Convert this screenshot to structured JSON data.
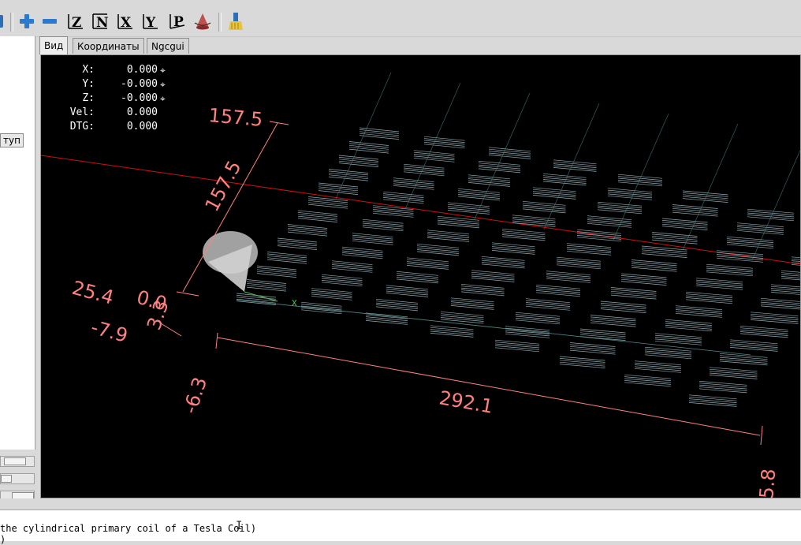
{
  "toolbar": {
    "buttons": [
      {
        "name": "zoom-in",
        "icon": "plus-icon"
      },
      {
        "name": "zoom-out",
        "icon": "minus-icon"
      },
      {
        "name": "view-z",
        "label": "Z"
      },
      {
        "name": "view-z2",
        "label": "Z"
      },
      {
        "name": "view-x",
        "label": "X"
      },
      {
        "name": "view-y",
        "label": "Y"
      },
      {
        "name": "view-p",
        "label": "P"
      },
      {
        "name": "toggle-rotate",
        "icon": "rotate-icon"
      },
      {
        "name": "clear-backplot",
        "icon": "brush-icon"
      }
    ]
  },
  "left_panel": {
    "button_label": "туп"
  },
  "tabs": [
    {
      "label": "Вид",
      "active": true
    },
    {
      "label": "Координаты",
      "active": false
    },
    {
      "label": "Ngcgui",
      "active": false
    }
  ],
  "dro": [
    {
      "label": "X:",
      "value": "0.000",
      "icon": "home-icon"
    },
    {
      "label": "Y:",
      "value": "-0.000",
      "icon": "home-icon"
    },
    {
      "label": "Z:",
      "value": "-0.000",
      "icon": "home-icon"
    },
    {
      "label": "Vel:",
      "value": "0.000"
    },
    {
      "label": "DTG:",
      "value": "0.000"
    }
  ],
  "dimensions": {
    "top_left": "157.5",
    "left_diag": "157.5",
    "left_a": "25.4",
    "left_b": "0.0",
    "left_c": "-7.9",
    "left_d": "3.3",
    "bottom_left": "-6.3",
    "bottom_mid": "292.1",
    "bottom_right": "5.8"
  },
  "colors": {
    "viewport_bg": "#000000",
    "dimension": "#ff8080",
    "toolpath": "#a9c7cf",
    "axis_red": "#d01010"
  },
  "status": {
    "gcode_line": "the cylindrical primary coil of a Tesla Coil)",
    "gcode_line2": ")"
  }
}
